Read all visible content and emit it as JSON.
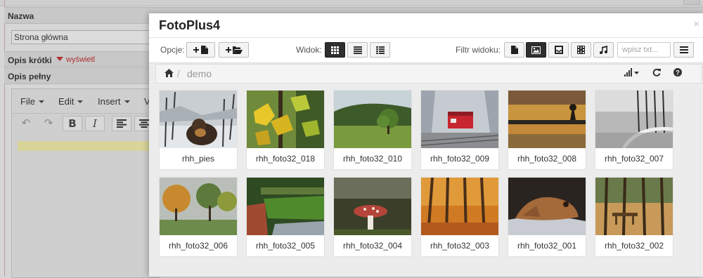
{
  "background": {
    "field_name_label": "Nazwa",
    "field_name_value": "Strona główna",
    "short_desc_label": "Opis krótki",
    "short_desc_toggle": "wyświetl",
    "full_desc_label": "Opis pełny",
    "editor_menu": [
      "File",
      "Edit",
      "Insert",
      "V"
    ]
  },
  "modal": {
    "title": "FotoPlus4",
    "close": "×",
    "toolbar": {
      "options_label": "Opcje:",
      "view_label": "Widok:",
      "filter_label": "Filtr widoku:",
      "search_placeholder": "wpisz txt..."
    },
    "breadcrumb": {
      "sep": "/",
      "folder": "demo"
    },
    "files": [
      {
        "name": "rhh_pies"
      },
      {
        "name": "rhh_foto32_018"
      },
      {
        "name": "rhh_foto32_010"
      },
      {
        "name": "rhh_foto32_009"
      },
      {
        "name": "rhh_foto32_008"
      },
      {
        "name": "rhh_foto32_007"
      },
      {
        "name": "rhh_foto32_006"
      },
      {
        "name": "rhh_foto32_005"
      },
      {
        "name": "rhh_foto32_004"
      },
      {
        "name": "rhh_foto32_003"
      },
      {
        "name": "rhh_foto32_001"
      },
      {
        "name": "rhh_foto32_002"
      }
    ]
  }
}
